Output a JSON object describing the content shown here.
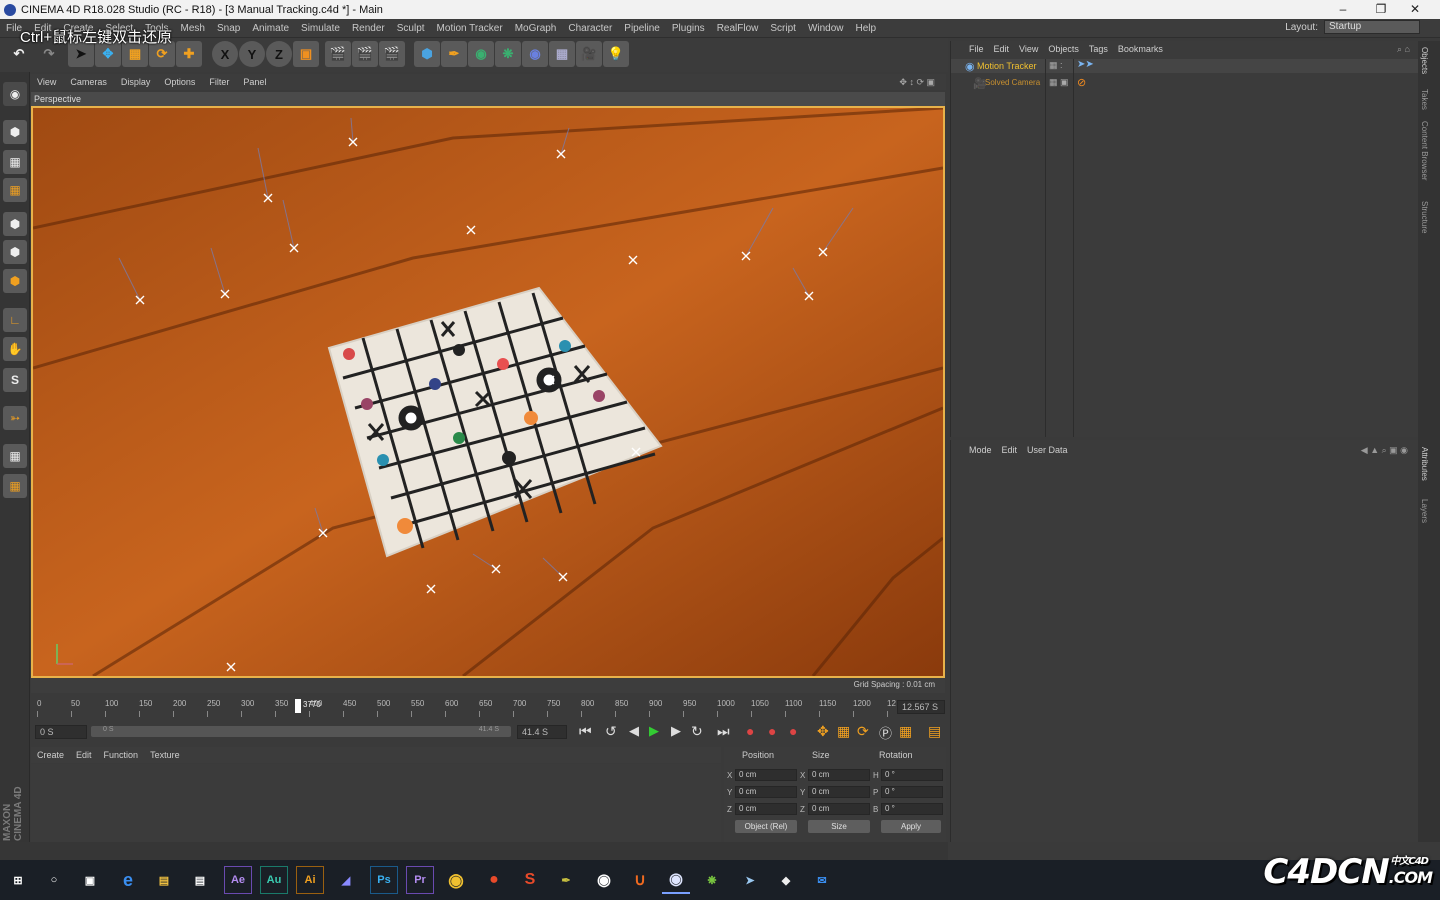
{
  "window": {
    "title": "CINEMA 4D R18.028 Studio (RC - R18) - [3 Manual Tracking.c4d *] - Main",
    "minimize": "–",
    "restore": "❐",
    "close": "✕"
  },
  "overlay_hint": "Ctrl+鼠标左键双击还原",
  "menu": [
    "File",
    "Edit",
    "Create",
    "Select",
    "Tools",
    "Mesh",
    "Snap",
    "Animate",
    "Simulate",
    "Render",
    "Sculpt",
    "Motion Tracker",
    "MoGraph",
    "Character",
    "Pipeline",
    "Plugins",
    "RealFlow",
    "Script",
    "Window",
    "Help"
  ],
  "layout": {
    "label": "Layout:",
    "value": "Startup"
  },
  "toolbar": {
    "x": "X",
    "y": "Y",
    "z": "Z"
  },
  "viewport": {
    "menu": [
      "View",
      "Cameras",
      "Display",
      "Options",
      "Filter",
      "Panel"
    ],
    "label": "Perspective",
    "grid_spacing": "Grid Spacing : 0.01 cm"
  },
  "timeline": {
    "ticks": [
      "0",
      "50",
      "100",
      "150",
      "200",
      "250",
      "300",
      "350",
      "400",
      "450",
      "500",
      "550",
      "600",
      "650",
      "700",
      "750",
      "800",
      "850",
      "900",
      "950",
      "1000",
      "1050",
      "1100",
      "1150",
      "1200",
      "12"
    ],
    "current_frame_label": "3770",
    "current_time": "12.567 S",
    "current_fraction": 0.3
  },
  "transport": {
    "start": "0 S",
    "range_start": "0 S",
    "range_end": "41.4 S",
    "end": "41.4 S"
  },
  "material": {
    "menu": [
      "Create",
      "Edit",
      "Function",
      "Texture"
    ]
  },
  "coords": {
    "headers": [
      "Position",
      "Size",
      "Rotation"
    ],
    "rows": [
      {
        "axis": "X",
        "pos": "0 cm",
        "saxis": "X",
        "size": "0 cm",
        "raxis": "H",
        "rot": "0 °"
      },
      {
        "axis": "Y",
        "pos": "0 cm",
        "saxis": "Y",
        "size": "0 cm",
        "raxis": "P",
        "rot": "0 °"
      },
      {
        "axis": "Z",
        "pos": "0 cm",
        "saxis": "Z",
        "size": "0 cm",
        "raxis": "B",
        "rot": "0 °"
      }
    ],
    "mode": "Object (Rel)",
    "size_mode": "Size",
    "apply": "Apply"
  },
  "objects": {
    "menu": [
      "File",
      "Edit",
      "View",
      "Objects",
      "Tags",
      "Bookmarks"
    ],
    "items": [
      {
        "name": "Motion Tracker"
      },
      {
        "name": "Solved Camera"
      }
    ]
  },
  "attributes": {
    "menu": [
      "Mode",
      "Edit",
      "User Data"
    ]
  },
  "side_tabs": [
    "Objects",
    "Takes",
    "Content Browser",
    "Structure",
    "Attributes",
    "Layers"
  ],
  "maxon": "MAXON CINEMA 4D",
  "brand": {
    "main": "C4DCN",
    "sub": ".COM",
    "tag": "中文C4D"
  },
  "taskbar": [
    "Ae",
    "Au",
    "Ai",
    "Pr",
    "Ps"
  ]
}
